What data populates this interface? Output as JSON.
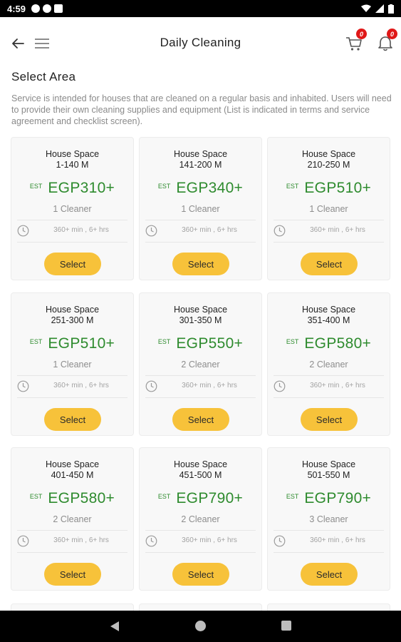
{
  "status_bar": {
    "time": "4:59"
  },
  "header": {
    "title": "Daily Cleaning",
    "cart_badge": "0",
    "notification_badge": "0"
  },
  "section": {
    "title": "Select Area",
    "description": "Service is intended for houses that are cleaned on a regular basis and inhabited. Users will need to provide their own cleaning supplies and equipment (List is indicated in terms and service agreement and checklist screen)."
  },
  "est_label": "EST",
  "select_label": "Select",
  "cards": [
    {
      "space": "House Space",
      "range": "1-140 M",
      "price": "EGP310+",
      "cleaners": "1 Cleaner",
      "duration": "360+ min , 6+ hrs"
    },
    {
      "space": "House Space",
      "range": "141-200 M",
      "price": "EGP340+",
      "cleaners": "1 Cleaner",
      "duration": "360+ min , 6+ hrs"
    },
    {
      "space": "House Space",
      "range": "210-250 M",
      "price": "EGP510+",
      "cleaners": "1 Cleaner",
      "duration": "360+ min , 6+ hrs"
    },
    {
      "space": "House Space",
      "range": "251-300 M",
      "price": "EGP510+",
      "cleaners": "1 Cleaner",
      "duration": "360+ min , 6+ hrs"
    },
    {
      "space": "House Space",
      "range": "301-350 M",
      "price": "EGP550+",
      "cleaners": "2 Cleaner",
      "duration": "360+ min , 6+ hrs"
    },
    {
      "space": "House Space",
      "range": "351-400 M",
      "price": "EGP580+",
      "cleaners": "2 Cleaner",
      "duration": "360+ min , 6+ hrs"
    },
    {
      "space": "House Space",
      "range": "401-450 M",
      "price": "EGP580+",
      "cleaners": "2 Cleaner",
      "duration": "360+ min , 6+ hrs"
    },
    {
      "space": "House Space",
      "range": "451-500 M",
      "price": "EGP790+",
      "cleaners": "2 Cleaner",
      "duration": "360+ min , 6+ hrs"
    },
    {
      "space": "House Space",
      "range": "501-550 M",
      "price": "EGP790+",
      "cleaners": "3 Cleaner",
      "duration": "360+ min , 6+ hrs"
    }
  ],
  "colors": {
    "price": "#2e8b2e",
    "button": "#f7c23a",
    "badge": "#e01818"
  }
}
